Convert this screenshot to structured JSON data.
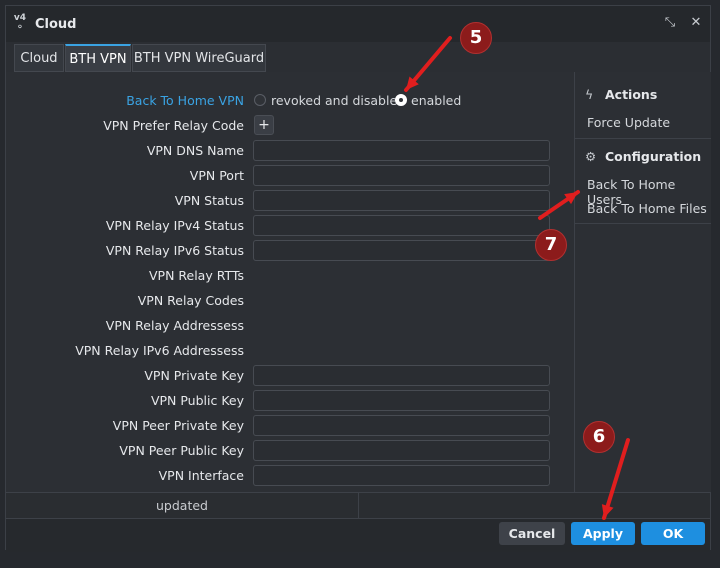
{
  "window": {
    "title": "Cloud",
    "icon_label_top": "v4",
    "icon_name": "router-icon",
    "buttons": [
      "restore-icon",
      "close-icon"
    ],
    "restore_glyph": "⤡",
    "close_glyph": "✕"
  },
  "tabs": [
    {
      "label": "Cloud",
      "active": false
    },
    {
      "label": "BTH VPN",
      "active": true
    },
    {
      "label": "BTH VPN WireGuard",
      "active": false
    }
  ],
  "form": {
    "bth_label": "Back To Home VPN",
    "radio_options": [
      {
        "label": "revoked and disabled",
        "selected": false
      },
      {
        "label": "enabled",
        "selected": true
      }
    ],
    "prefer_relay_label": "VPN Prefer Relay Code",
    "prefer_relay_button": "+",
    "fields": [
      {
        "label": "VPN DNS Name",
        "has_input": true,
        "value": ""
      },
      {
        "label": "VPN Port",
        "has_input": true,
        "value": ""
      },
      {
        "label": "VPN Status",
        "has_input": true,
        "value": ""
      },
      {
        "label": "VPN Relay IPv4 Status",
        "has_input": true,
        "value": ""
      },
      {
        "label": "VPN Relay IPv6 Status",
        "has_input": true,
        "value": ""
      },
      {
        "label": "VPN Relay RTTs",
        "has_input": false,
        "value": ""
      },
      {
        "label": "VPN Relay Codes",
        "has_input": false,
        "value": ""
      },
      {
        "label": "VPN Relay Addressess",
        "has_input": false,
        "value": ""
      },
      {
        "label": "VPN Relay IPv6 Addressess",
        "has_input": false,
        "value": ""
      },
      {
        "label": "VPN Private Key",
        "has_input": true,
        "value": ""
      },
      {
        "label": "VPN Public Key",
        "has_input": true,
        "value": ""
      },
      {
        "label": "VPN Peer Private Key",
        "has_input": true,
        "value": ""
      },
      {
        "label": "VPN Peer Public Key",
        "has_input": true,
        "value": ""
      },
      {
        "label": "VPN Interface",
        "has_input": true,
        "value": ""
      }
    ]
  },
  "side_panel": {
    "actions_title": "Actions",
    "actions_icon": "bolt-icon",
    "actions_glyph": "ϟ",
    "actions": [
      "Force Update"
    ],
    "config_title": "Configuration",
    "config_icon": "gear-icon",
    "config_glyph": "⚙",
    "config_items": [
      "Back To Home Users",
      "Back To Home Files"
    ]
  },
  "status": {
    "text": "updated"
  },
  "footer": {
    "cancel": "Cancel",
    "apply": "Apply",
    "ok": "OK"
  },
  "annotations": {
    "color": "#e01e1e",
    "badges": [
      "5",
      "6",
      "7"
    ]
  }
}
